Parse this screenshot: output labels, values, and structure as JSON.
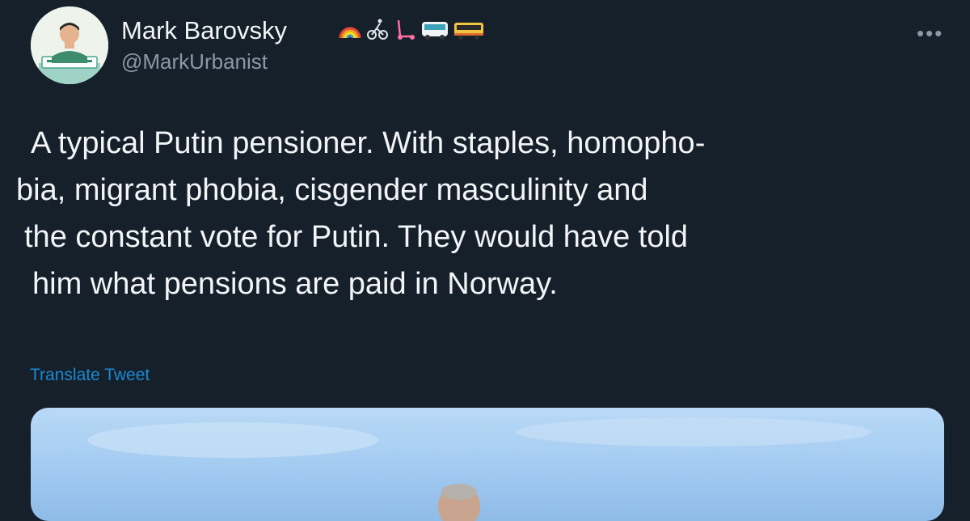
{
  "author": {
    "display_name": "Mark Barovsky",
    "handle": "@MarkUrbanist",
    "name_emojis": [
      "rainbow-icon",
      "cyclist-icon",
      "scooter-icon",
      "bus-icon",
      "tram-icon"
    ]
  },
  "menu": {
    "more_label": "•••"
  },
  "tweet": {
    "lines": [
      "A typical Putin pensioner. With staples, homopho-",
      "bia, migrant phobia, cisgender masculinity and",
      "the constant vote for Putin. They would have told",
      "him what pensions are paid in Norway."
    ],
    "translate_label": "Translate Tweet"
  },
  "colors": {
    "background": "#15202b",
    "text": "#f2f4f6",
    "secondary_text": "#8b98a5",
    "link": "#1d9bf0"
  }
}
